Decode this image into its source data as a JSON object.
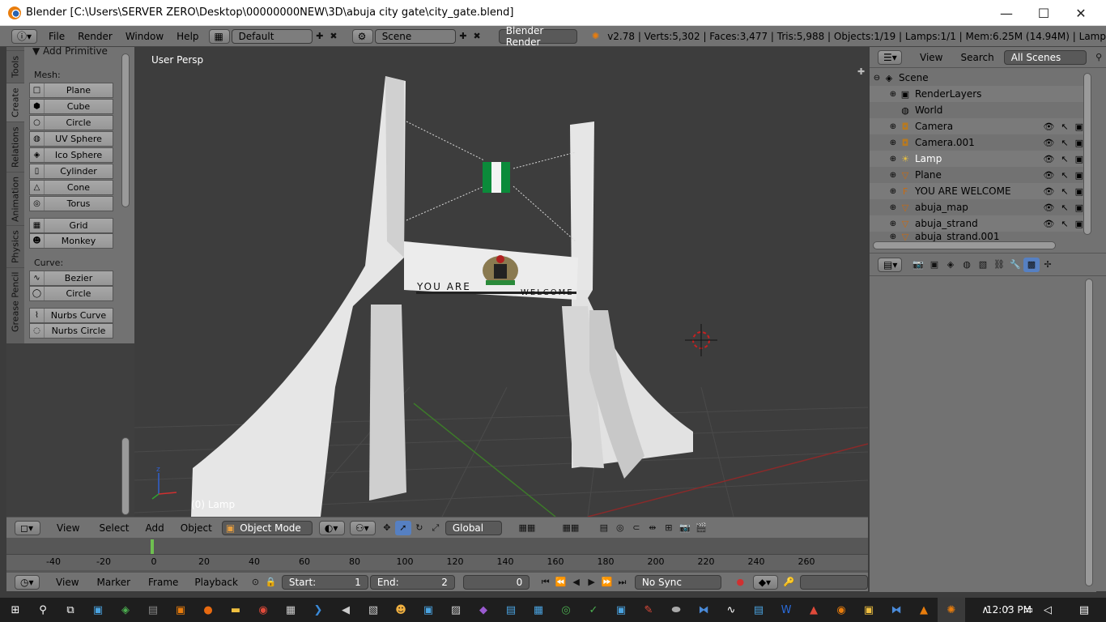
{
  "window": {
    "title": "Blender [C:\\Users\\SERVER ZERO\\Desktop\\00000000NEW\\3D\\abuja city gate\\city_gate.blend]",
    "minimize": "—",
    "maximize": "☐",
    "close": "✕"
  },
  "info_header": {
    "menus": [
      "File",
      "Render",
      "Window",
      "Help"
    ],
    "layout": "Default",
    "scene": "Scene",
    "engine": "Blender Render",
    "stats": "v2.78 | Verts:5,302 | Faces:3,477 | Tris:5,988 | Objects:1/19 | Lamps:1/1 | Mem:6.25M (14.94M) | Lamp"
  },
  "tool_shelf": {
    "tabs": [
      "Tools",
      "Create",
      "Relations",
      "Animation",
      "Physics",
      "Grease Pencil"
    ],
    "active_tab": "Create",
    "panel_title": "Add Primitive",
    "mesh_label": "Mesh:",
    "mesh_items": [
      "Plane",
      "Cube",
      "Circle",
      "UV Sphere",
      "Ico Sphere",
      "Cylinder",
      "Cone",
      "Torus"
    ],
    "extra_items": [
      "Grid",
      "Monkey"
    ],
    "curve_label": "Curve:",
    "curve_items": [
      "Bezier",
      "Circle"
    ],
    "nurbs_items": [
      "Nurbs Curve",
      "Nurbs Circle"
    ]
  },
  "viewport": {
    "view_label": "User Persp",
    "active_object": "(0) Lamp",
    "sign_left": "YOU ARE",
    "sign_right": "WELCOME"
  },
  "viewport_header": {
    "menus": [
      "View",
      "Select",
      "Add",
      "Object"
    ],
    "mode": "Object Mode",
    "orientation": "Global"
  },
  "timeline": {
    "ticks": [
      "-40",
      "-20",
      "0",
      "20",
      "40",
      "60",
      "80",
      "100",
      "120",
      "140",
      "160",
      "180",
      "200",
      "220",
      "240",
      "260"
    ],
    "menus": [
      "View",
      "Marker",
      "Frame",
      "Playback"
    ],
    "start_label": "Start:",
    "start_value": "1",
    "end_label": "End:",
    "end_value": "2",
    "current_frame": "0",
    "sync": "No Sync"
  },
  "outliner": {
    "menus": [
      "View",
      "Search"
    ],
    "filter": "All Scenes",
    "rows": [
      {
        "name": "Scene",
        "icon": "scene-icon"
      },
      {
        "name": "RenderLayers",
        "icon": "renderlayers-icon"
      },
      {
        "name": "World",
        "icon": "world-icon"
      },
      {
        "name": "Camera",
        "icon": "camera-icon"
      },
      {
        "name": "Camera.001",
        "icon": "camera-icon"
      },
      {
        "name": "Lamp",
        "icon": "lamp-icon"
      },
      {
        "name": "Plane",
        "icon": "mesh-icon"
      },
      {
        "name": "YOU ARE WELCOME",
        "icon": "text-icon"
      },
      {
        "name": "abuja_map",
        "icon": "mesh-icon"
      },
      {
        "name": "abuja_strand",
        "icon": "mesh-icon"
      },
      {
        "name": "abuja_strand.001",
        "icon": "mesh-icon"
      }
    ]
  },
  "taskbar": {
    "time": "12:03 PM"
  }
}
